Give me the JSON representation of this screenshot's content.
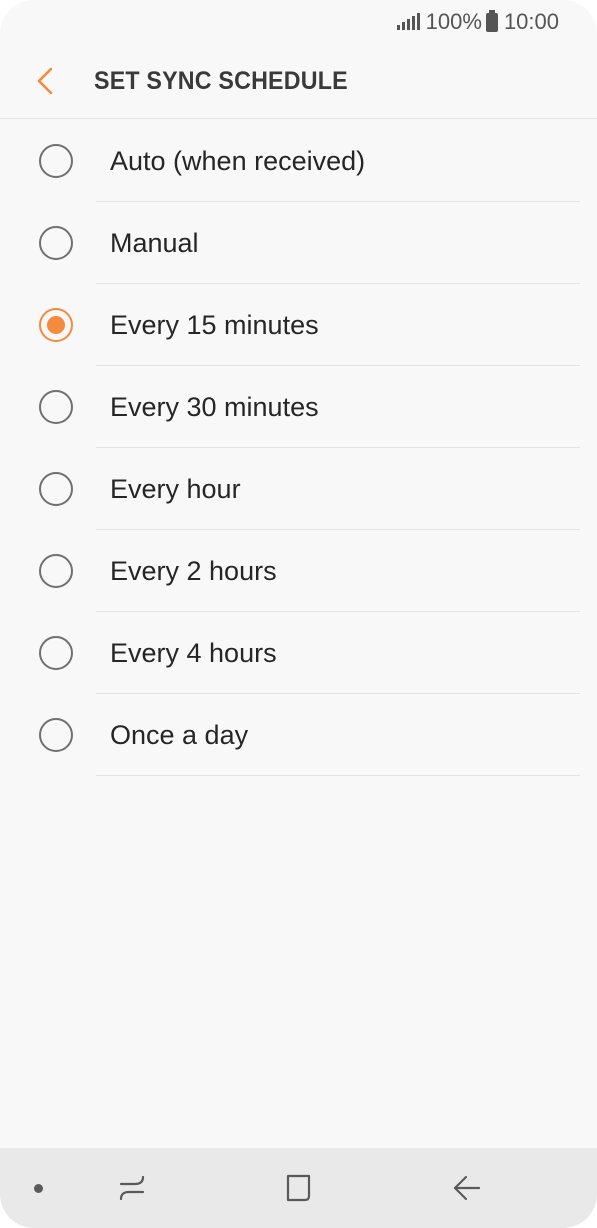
{
  "status_bar": {
    "battery_text": "100%",
    "time": "10:00",
    "icons": [
      "signal-icon",
      "battery-icon"
    ]
  },
  "header": {
    "back_icon": "chevron-left-icon",
    "title": "SET SYNC SCHEDULE"
  },
  "options": [
    {
      "label": "Auto (when received)",
      "selected": false
    },
    {
      "label": "Manual",
      "selected": false
    },
    {
      "label": "Every 15 minutes",
      "selected": true
    },
    {
      "label": "Every 30 minutes",
      "selected": false
    },
    {
      "label": "Every hour",
      "selected": false
    },
    {
      "label": "Every 2 hours",
      "selected": false
    },
    {
      "label": "Every 4 hours",
      "selected": false
    },
    {
      "label": "Once a day",
      "selected": false
    }
  ],
  "nav_bar": {
    "items": [
      "dot-indicator-icon",
      "recent-apps-icon",
      "home-icon",
      "back-arrow-icon"
    ]
  },
  "colors": {
    "accent": "#f58b3c",
    "background": "#f8f8f8",
    "nav_background": "#e9e9e9",
    "divider": "#e2e2e2",
    "text": "#262626"
  }
}
